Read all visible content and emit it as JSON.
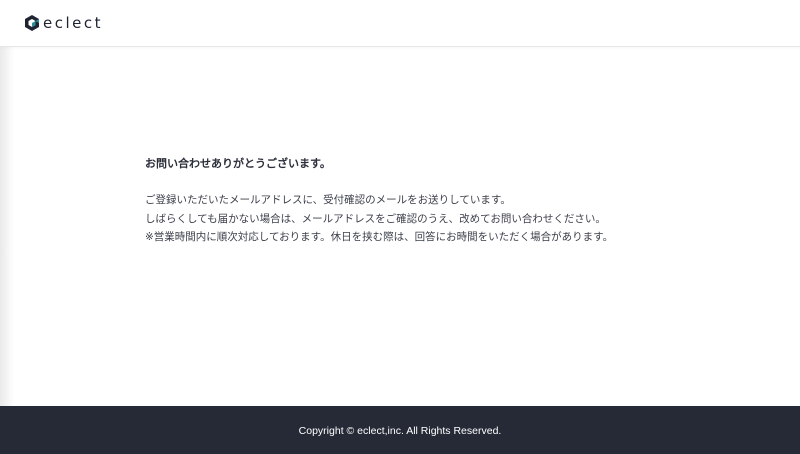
{
  "header": {
    "logo_text": "eclect",
    "logo_icon": "cube-logo-icon"
  },
  "main": {
    "title": "お問い合わせありがとうございます。",
    "lines": [
      "ご登録いただいたメールアドレスに、受付確認のメールをお送りしています。",
      "しばらくしても届かない場合は、メールアドレスをご確認のうえ、改めてお問い合わせください。",
      "※営業時間内に順次対応しております。休日を挟む際は、回答にお時間をいただく場合があります。"
    ]
  },
  "footer": {
    "copyright": "Copyright © eclect,inc. All Rights Reserved."
  },
  "colors": {
    "brand_dark": "#262a37",
    "logo_teal": "#2f8f97",
    "text": "#3b3f4a"
  }
}
